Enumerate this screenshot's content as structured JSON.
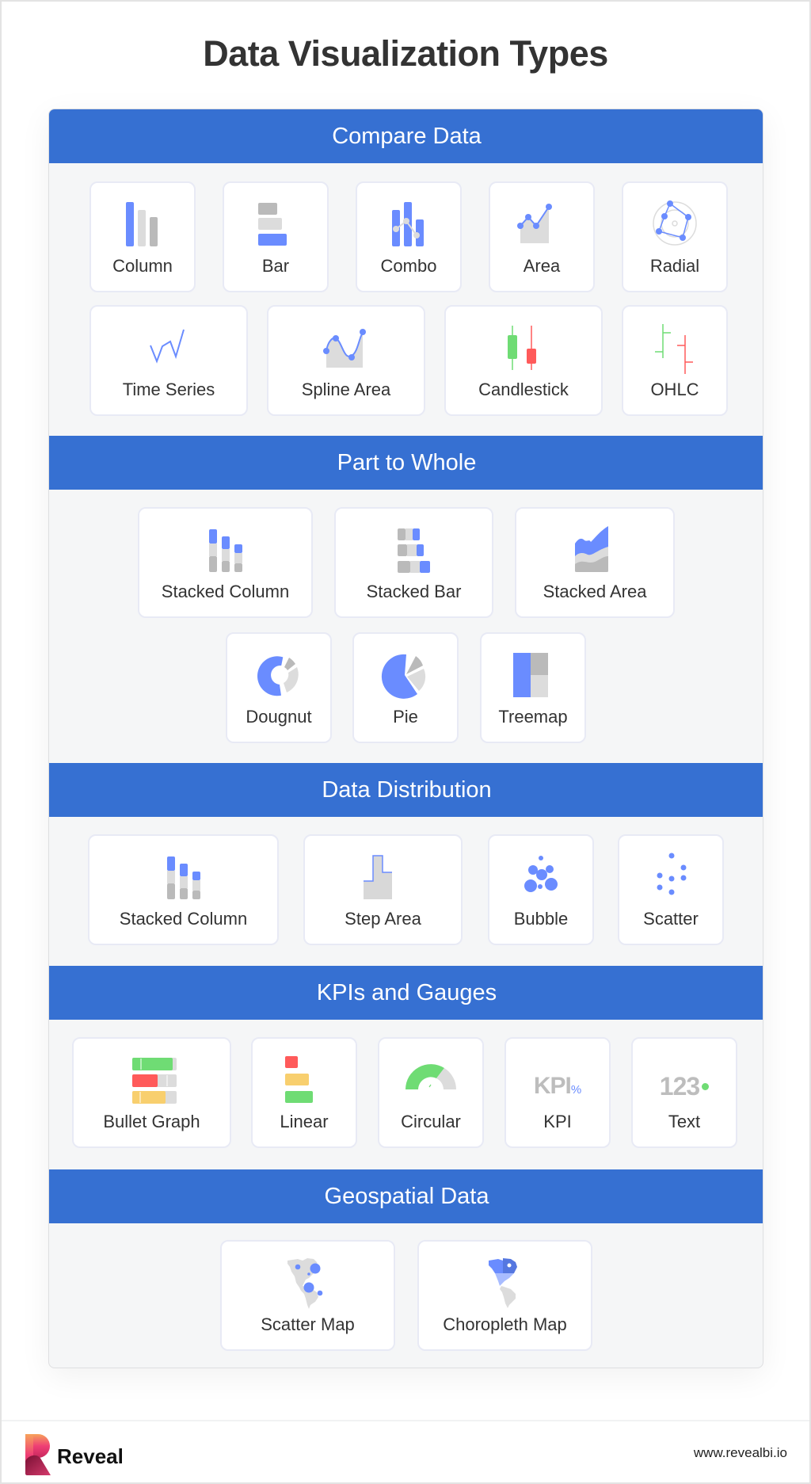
{
  "page": {
    "title": "Data Visualization Types"
  },
  "colors": {
    "header_blue": "#3670d2",
    "accent_blue": "#6a8cff",
    "light_gray": "#dcdcdc",
    "mid_gray": "#bababa",
    "green": "#6fdc74",
    "red": "#ff5a5a",
    "yellow": "#f8cf6e"
  },
  "sections": [
    {
      "title": "Compare Data",
      "items": [
        {
          "label": "Column",
          "icon": "column-chart-icon"
        },
        {
          "label": "Bar",
          "icon": "bar-chart-icon"
        },
        {
          "label": "Combo",
          "icon": "combo-chart-icon"
        },
        {
          "label": "Area",
          "icon": "area-chart-icon"
        },
        {
          "label": "Radial",
          "icon": "radial-chart-icon"
        },
        {
          "label": "Time Series",
          "icon": "time-series-icon"
        },
        {
          "label": "Spline Area",
          "icon": "spline-area-icon"
        },
        {
          "label": "Candlestick",
          "icon": "candlestick-icon"
        },
        {
          "label": "OHLC",
          "icon": "ohlc-icon"
        }
      ]
    },
    {
      "title": "Part to Whole",
      "items": [
        {
          "label": "Stacked Column",
          "icon": "stacked-column-icon"
        },
        {
          "label": "Stacked Bar",
          "icon": "stacked-bar-icon"
        },
        {
          "label": "Stacked Area",
          "icon": "stacked-area-icon"
        },
        {
          "label": "Dougnut",
          "icon": "doughnut-chart-icon"
        },
        {
          "label": "Pie",
          "icon": "pie-chart-icon"
        },
        {
          "label": "Treemap",
          "icon": "treemap-icon"
        }
      ]
    },
    {
      "title": "Data Distribution",
      "items": [
        {
          "label": "Stacked Column",
          "icon": "stacked-column-icon"
        },
        {
          "label": "Step Area",
          "icon": "step-area-icon"
        },
        {
          "label": "Bubble",
          "icon": "bubble-chart-icon"
        },
        {
          "label": "Scatter",
          "icon": "scatter-plot-icon"
        }
      ]
    },
    {
      "title": "KPIs and Gauges",
      "items": [
        {
          "label": "Bullet Graph",
          "icon": "bullet-graph-icon"
        },
        {
          "label": "Linear",
          "icon": "linear-gauge-icon"
        },
        {
          "label": "Circular",
          "icon": "circular-gauge-icon"
        },
        {
          "label": "KPI",
          "icon": "kpi-icon",
          "glyph": "KPI",
          "glyph_sup": "%"
        },
        {
          "label": "Text",
          "icon": "text-gauge-icon",
          "glyph": "123"
        }
      ]
    },
    {
      "title": "Geospatial Data",
      "items": [
        {
          "label": "Scatter Map",
          "icon": "scatter-map-icon"
        },
        {
          "label": "Choropleth Map",
          "icon": "choropleth-map-icon"
        }
      ]
    }
  ],
  "footer": {
    "brand": "Reveal",
    "url": "www.revealbi.io"
  }
}
